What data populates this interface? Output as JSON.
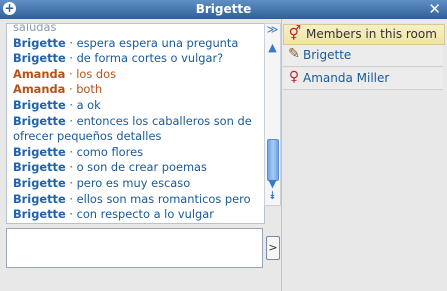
{
  "window": {
    "title": "Brigette"
  },
  "chat": {
    "lines": [
      {
        "speaker": "Brigette",
        "text": "espera espera una pregunta"
      },
      {
        "speaker": "Brigette",
        "text": "de forma cortes o vulgar?"
      },
      {
        "speaker": "Amanda",
        "text": "los dos"
      },
      {
        "speaker": "Amanda",
        "text": "both"
      },
      {
        "speaker": "Brigette",
        "text": "a ok"
      },
      {
        "speaker": "Brigette",
        "text": "entonces los caballeros son de ofrecer pequeños detalles"
      },
      {
        "speaker": "Brigette",
        "text": "como flores"
      },
      {
        "speaker": "Brigette",
        "text": "o son de crear poemas"
      },
      {
        "speaker": "Brigette",
        "text": "pero es muy escaso"
      },
      {
        "speaker": "Brigette",
        "text": "ellos son mas romanticos pero"
      },
      {
        "speaker": "Brigette",
        "text": "con respecto a lo vulgar"
      }
    ],
    "separator": " · ",
    "cut_line_text": "saludas"
  },
  "input": {
    "value": ""
  },
  "send_label": ">",
  "members_panel": {
    "header_label": "Members in this room",
    "members": [
      {
        "name": "Brigette",
        "icon": "pencil-icon"
      },
      {
        "name": "Amanda Miller",
        "icon": "female-symbol-icon"
      }
    ]
  },
  "colors": {
    "title_bar": "#3f6fa8",
    "brigette_name": "#1f62ad",
    "amanda_name": "#b55218",
    "panel_header": "#f2e9b6"
  }
}
